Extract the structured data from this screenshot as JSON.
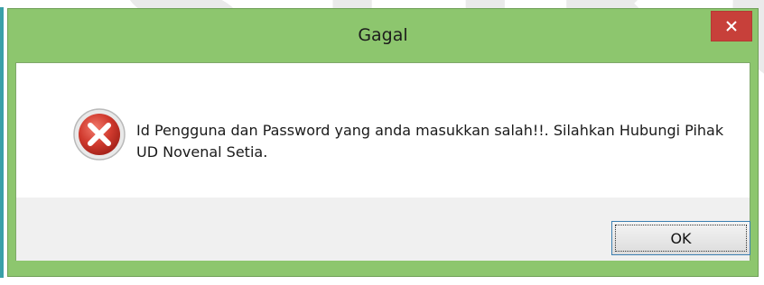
{
  "background": {
    "watermark_main": "STIKOM",
    "watermark_sub": "SURABAYA"
  },
  "dialog": {
    "title": "Gagal",
    "close_symbol": "✕",
    "icon": "error-icon",
    "message": "Id Pengguna dan Password yang anda masukkan salah!!. Silahkan Hubungi Pihak UD Novenal Setia.",
    "ok_label": "OK"
  },
  "colors": {
    "titlebar": "#8dc66e",
    "close_button": "#c7403a",
    "error_icon": "#d03a2e",
    "button_bar": "#f0f0f0",
    "ok_border": "#3c7fb1"
  }
}
